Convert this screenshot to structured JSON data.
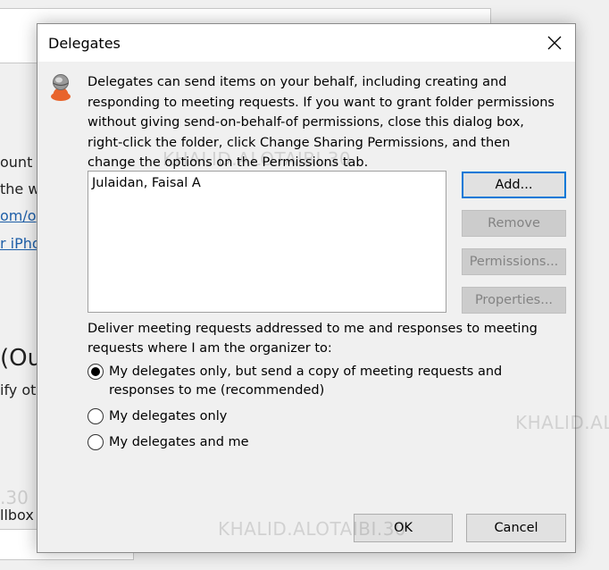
{
  "background": {
    "texts": [
      "ount c",
      "the w",
      "om/o",
      "r iPho",
      "(Ou",
      "ify oth",
      ".30",
      "llbox I"
    ]
  },
  "watermarks": [
    "KHALID.ALOTAIBI.30",
    "KHALID.AL",
    "KHALID.ALOTAIBI.30"
  ],
  "dialog": {
    "title": "Delegates",
    "description": "Delegates can send items on your behalf, including creating and responding to meeting requests. If you want to grant folder permissions without giving send-on-behalf-of permissions, close this dialog box, right-click the folder, click Change Sharing Permissions, and then change the options on the Permissions tab.",
    "delegates": [
      "Julaidan, Faisal A"
    ],
    "buttons": {
      "add": "Add...",
      "remove": "Remove",
      "permissions": "Permissions...",
      "properties": "Properties..."
    },
    "deliver_label": "Deliver meeting requests addressed to me and responses to meeting requests where I am the organizer to:",
    "options": [
      {
        "label": "My delegates only, but send a copy of meeting requests and responses to me (recommended)",
        "selected": true
      },
      {
        "label": "My delegates only",
        "selected": false
      },
      {
        "label": "My delegates and me",
        "selected": false
      }
    ],
    "ok_label": "OK",
    "cancel_label": "Cancel"
  },
  "colors": {
    "focus_border": "#0078d7",
    "link": "#1e5fa8",
    "icon_accent": "#e8642c"
  },
  "icons": [
    "close-icon",
    "delegate-person-icon"
  ]
}
